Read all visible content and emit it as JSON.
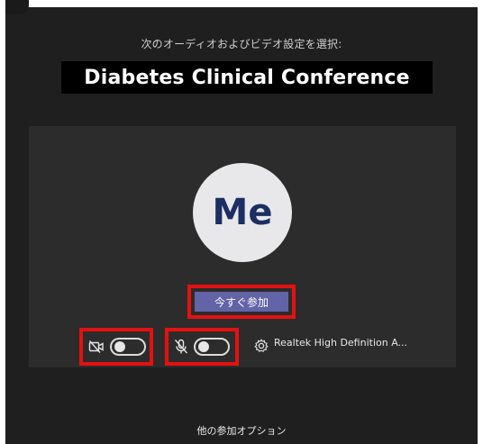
{
  "header": {
    "subtitle": "次のオーディオおよびビデオ設定を選択:",
    "meeting_title": "Diabetes Clinical Conference"
  },
  "preview": {
    "avatar_initials": "Me",
    "join_label": "今すぐ参加",
    "camera_toggle": {
      "state": "off"
    },
    "mic_toggle": {
      "state": "off"
    },
    "audio_device": "Realtek High Definition A..."
  },
  "footer": {
    "more_options": "他の参加オプション"
  },
  "colors": {
    "background": "#1f1f1f",
    "card": "#2d2c2c",
    "accent": "#6264a7",
    "highlight": "#e41111",
    "avatar_text": "#1c2e63"
  }
}
